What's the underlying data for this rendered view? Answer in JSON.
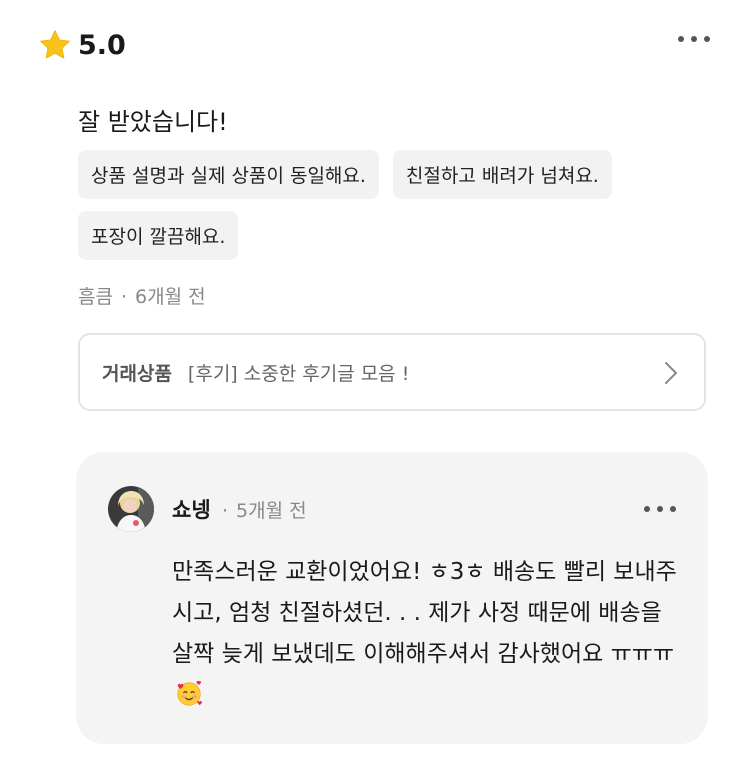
{
  "rating": {
    "icon": "star-icon",
    "value": "5.0",
    "star_color": "#f8c21a"
  },
  "review": {
    "text": "잘 받았습니다!",
    "tags": [
      "상품 설명과 실제 상품이 동일해요.",
      "친절하고 배려가 넘쳐요.",
      "포장이 깔끔해요."
    ],
    "author": "흠큼",
    "time": "6개월 전"
  },
  "product": {
    "label": "거래상품",
    "title": "[후기] 소중한 후기글 모음 !"
  },
  "reply": {
    "name": "쇼넹",
    "time": "5개월 전",
    "body": "만족스러운 교환이었어요! ㅎ3ㅎ 배송도 빨리 보내주시고, 엄청 친절하셨던. . . 제가 사정 때문에 배송을 살짝 늦게 보냈데도 이해해주셔서 감사했어요 ㅠㅠㅠ",
    "emoji": "smiling-face-with-hearts-icon"
  }
}
